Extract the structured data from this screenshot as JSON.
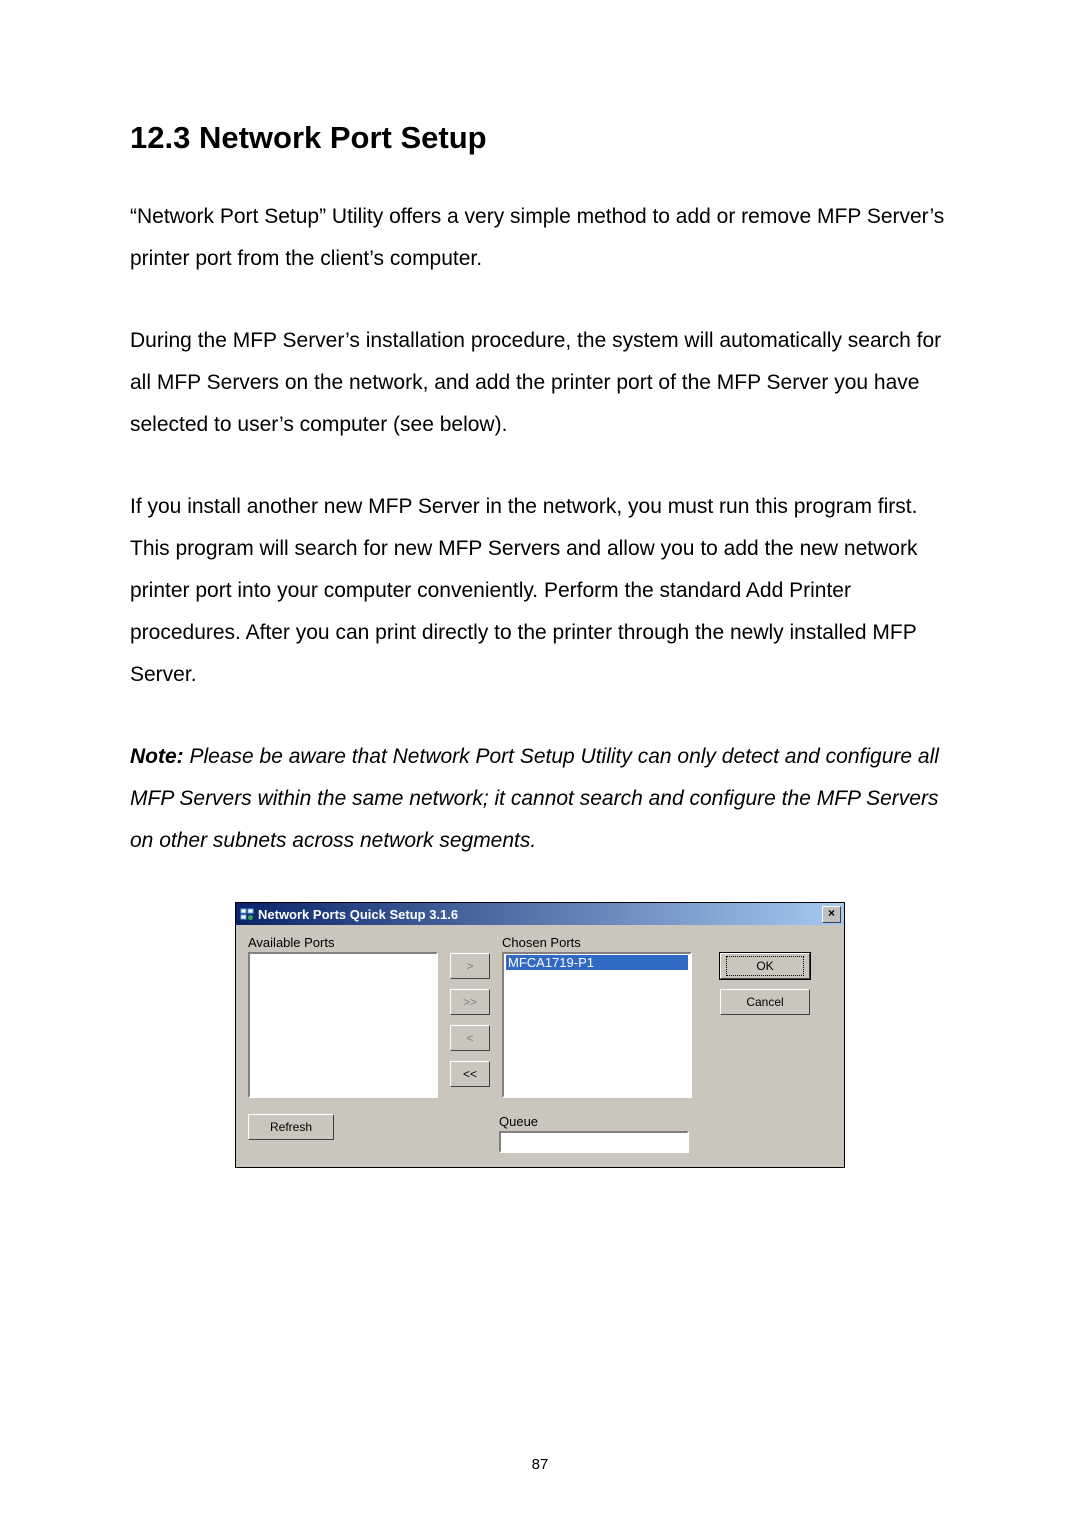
{
  "section": {
    "heading": "12.3  Network Port Setup"
  },
  "paras": {
    "p1": "“Network Port Setup” Utility offers a very simple method to add or remove MFP Server’s printer port from the client’s computer.",
    "p2": "During the MFP Server’s installation procedure, the system will automatically search for all MFP Servers on the network, and add the printer port of the MFP Server you have selected to user’s computer (see below).",
    "p3": "If you install another new MFP Server in the network, you must run this program first. This program will search for new MFP Servers and allow you to add the new network printer port into your computer conveniently. Perform the standard Add Printer procedures. After you can print directly to the printer through the newly installed MFP Server.",
    "note_lead": "Note:",
    "note_body": " Please be aware that Network Port Setup Utility can only detect and configure all MFP Servers within the same network; it cannot search and configure the MFP Servers on other subnets across network segments."
  },
  "window": {
    "title": "Network Ports Quick Setup 3.1.6",
    "close": "×",
    "available_label": "Available Ports",
    "chosen_label": "Chosen Ports",
    "chosen_item": "MFCA1719-P1",
    "queue_label": "Queue",
    "queue_value": "",
    "buttons": {
      "ok": "OK",
      "cancel": "Cancel",
      "refresh": "Refresh",
      "add_one": ">",
      "add_all": ">>",
      "remove_one": "<",
      "remove_all": "<<"
    }
  },
  "page_number": "87"
}
